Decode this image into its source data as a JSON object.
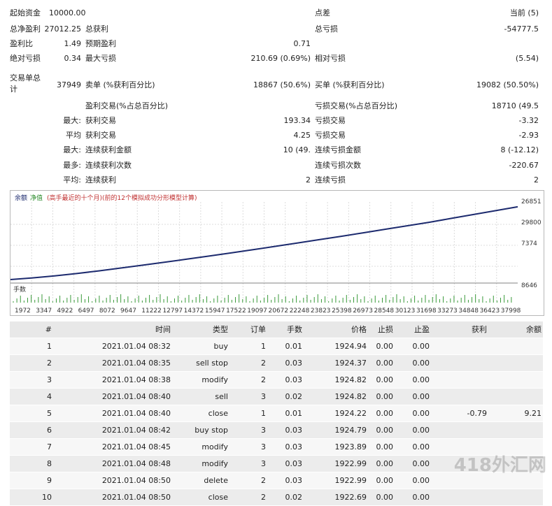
{
  "stats": {
    "initial_deposit_label": "起始资金",
    "initial_deposit_value": "10000.00",
    "spread_label": "点差",
    "spread_value": "当前 (5)",
    "net_profit_label": "总净盈利",
    "net_profit_value": "27012.25",
    "gross_profit_label": "总获利",
    "gross_loss_label": "总亏损",
    "gross_loss_value": "-54777.5",
    "profit_factor_label": "盈利比",
    "profit_factor_value": "1.49",
    "expected_payoff_label": "预期盈利",
    "expected_payoff_value": "0.71",
    "abs_dd_label": "绝对亏损",
    "abs_dd_value": "0.34",
    "max_dd_label": "最大亏损",
    "max_dd_value": "210.69 (0.69%)",
    "rel_dd_label": "相对亏损",
    "rel_dd_value": "(5.54)",
    "total_trades_label": "交易单总计",
    "total_trades_value": "37949",
    "short_label": "卖单 (%获利百分比)",
    "short_value": "18867 (50.6%)",
    "long_label": "买单 (%获利百分比)",
    "long_value": "19082 (50.50%)",
    "profit_trades_label": "盈利交易(%占总百分比)",
    "loss_trades_label": "亏损交易(%占总百分比)",
    "loss_trades_value": "18710 (49.5",
    "largest_label": "最大:",
    "largest_profit_label": "获利交易",
    "largest_profit_value": "193.34",
    "largest_loss_label": "亏损交易",
    "largest_loss_value": "-3.32",
    "average_label": "平均",
    "average_profit_label": "获利交易",
    "average_profit_value": "4.25",
    "average_loss_label": "亏损交易",
    "average_loss_value": "-2.93",
    "max_consec_label": "最大:",
    "max_consec_wins_money_label": "连续获利金额",
    "max_consec_wins_money_value": "10 (49.",
    "max_consec_losses_money_label": "连续亏损金额",
    "max_consec_losses_money_value": "8 (-12.12)",
    "maximal_label": "最多:",
    "max_consec_profit_count_label": "连续获利次数",
    "max_consec_loss_count_label": "连续亏损次数",
    "max_consec_loss_count_value": "-220.67",
    "avg_consec_label": "平均:",
    "avg_consec_wins_label": "连续获利",
    "avg_consec_wins_value": "2",
    "avg_consec_losses_label": "连续亏损",
    "avg_consec_losses_value": "2"
  },
  "chart": {
    "legend_balance": "余额",
    "legend_equity": "净值",
    "legend_note": "(高手最近的十个月)(前的12个模拟成功分形模型计算)",
    "right_axis": [
      "26851",
      "29800",
      "7374",
      "8646"
    ],
    "lot_label": "手数",
    "x_ticks": [
      "1972",
      "3347",
      "4922",
      "6497",
      "8072",
      "9647",
      "11222",
      "12797",
      "14372",
      "15947",
      "17522",
      "19097",
      "20672",
      "22248",
      "23823",
      "25398",
      "26973",
      "28548",
      "30123",
      "31698",
      "33273",
      "34848",
      "36423",
      "37998"
    ]
  },
  "chart_data": {
    "type": "line",
    "series": [
      {
        "values": [
          4,
          14,
          26,
          40,
          56,
          73,
          90,
          108,
          126,
          144,
          163,
          182,
          202,
          222,
          242,
          262,
          283,
          304,
          325,
          346,
          369,
          392,
          415,
          438
        ]
      }
    ],
    "ylim": [
      0,
      450
    ],
    "grid": true
  },
  "trades": {
    "headers": [
      "#",
      "时间",
      "类型",
      "订单",
      "手数",
      "价格",
      "止损",
      "止盈",
      "获利",
      "余额"
    ],
    "rows": [
      [
        "1",
        "2021.01.04 08:32",
        "buy",
        "1",
        "0.01",
        "1924.94",
        "0.00",
        "0.00",
        "",
        ""
      ],
      [
        "2",
        "2021.01.04 08:35",
        "sell stop",
        "2",
        "0.03",
        "1924.37",
        "0.00",
        "0.00",
        "",
        ""
      ],
      [
        "3",
        "2021.01.04 08:38",
        "modify",
        "2",
        "0.03",
        "1924.82",
        "0.00",
        "0.00",
        "",
        ""
      ],
      [
        "4",
        "2021.01.04 08:40",
        "sell",
        "3",
        "0.02",
        "1924.82",
        "0.00",
        "0.00",
        "",
        ""
      ],
      [
        "5",
        "2021.01.04 08:40",
        "close",
        "1",
        "0.01",
        "1924.22",
        "0.00",
        "0.00",
        "-0.79",
        "9.21"
      ],
      [
        "6",
        "2021.01.04 08:42",
        "buy stop",
        "3",
        "0.03",
        "1924.79",
        "0.00",
        "0.00",
        "",
        ""
      ],
      [
        "7",
        "2021.01.04 08:45",
        "modify",
        "3",
        "0.03",
        "1923.89",
        "0.00",
        "0.00",
        "",
        ""
      ],
      [
        "8",
        "2021.01.04 08:48",
        "modify",
        "3",
        "0.03",
        "1922.99",
        "0.00",
        "0.00",
        "",
        ""
      ],
      [
        "9",
        "2021.01.04 08:50",
        "delete",
        "2",
        "0.03",
        "1922.99",
        "0.00",
        "0.00",
        "",
        ""
      ],
      [
        "10",
        "2021.01.04 08:50",
        "close",
        "2",
        "0.02",
        "1922.69",
        "0.00",
        "0.00",
        "",
        ""
      ]
    ]
  },
  "watermark": "418外汇网"
}
